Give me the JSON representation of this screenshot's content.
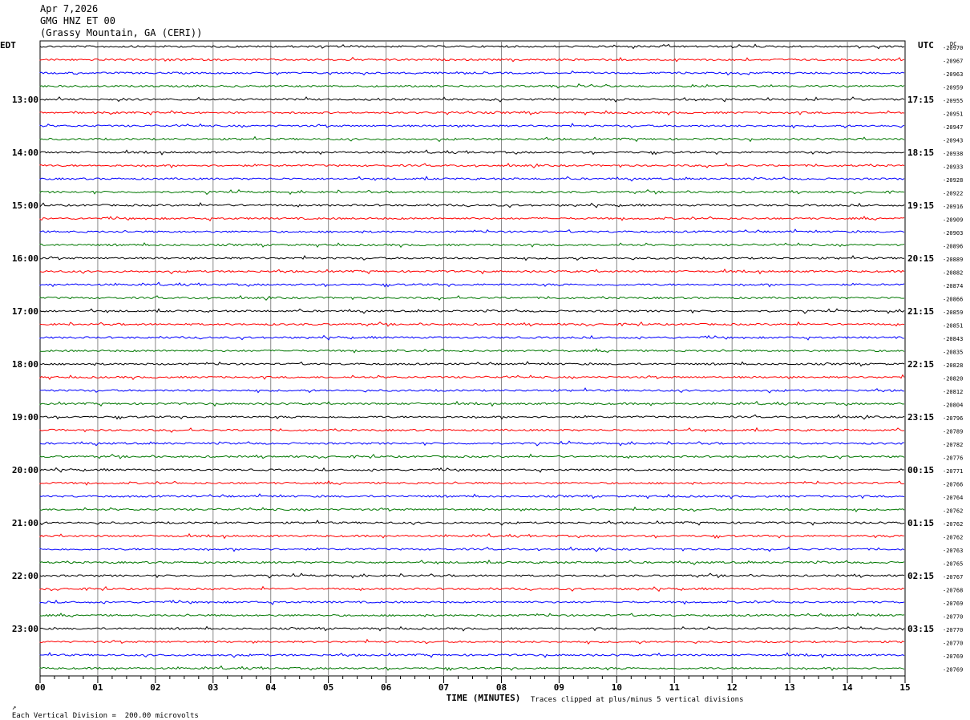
{
  "header": {
    "date": "Apr 7,2026",
    "channel": "GMG HNZ ET 00",
    "station": "(Grassy Mountain, GA (CERI))"
  },
  "chart_data": {
    "type": "line",
    "title": "GMG HNZ ET 00",
    "left_tz": "EDT",
    "right_tz": "UTC",
    "dc_label": "DC",
    "xlabel": "TIME (MINUTES)",
    "x_ticks": [
      "00",
      "01",
      "02",
      "03",
      "04",
      "05",
      "06",
      "07",
      "08",
      "09",
      "10",
      "11",
      "12",
      "13",
      "14",
      "15"
    ],
    "xlim": [
      0,
      15
    ],
    "left_hour_labels": [
      "13:00",
      "14:00",
      "15:00",
      "16:00",
      "17:00",
      "18:00",
      "19:00",
      "20:00",
      "21:00",
      "22:00",
      "23:00"
    ],
    "right_hour_labels": [
      "17:15",
      "18:15",
      "19:15",
      "20:15",
      "21:15",
      "22:15",
      "23:15",
      "00:15",
      "01:15",
      "02:15",
      "03:15"
    ],
    "trace_colors": [
      "#000000",
      "#ff0000",
      "#0000ff",
      "#007700"
    ],
    "dc_offsets": [
      "-20970",
      "-20967",
      "-20963",
      "-20959",
      "-20955",
      "-20951",
      "-20947",
      "-20943",
      "-20938",
      "-20933",
      "-20928",
      "-20922",
      "-20916",
      "-20909",
      "-20903",
      "-20896",
      "-20889",
      "-20882",
      "-20874",
      "-20866",
      "-20859",
      "-20851",
      "-20843",
      "-20835",
      "-20828",
      "-20820",
      "-20812",
      "-20804",
      "-20796",
      "-20789",
      "-20782",
      "-20776",
      "-20771",
      "-20766",
      "-20764",
      "-20762",
      "-20762",
      "-20762",
      "-20763",
      "-20765",
      "-20767",
      "-20768",
      "-20769",
      "-20770",
      "-20770",
      "-20770",
      "-20769",
      "-20769"
    ],
    "footer_scale": "Each Vertical Division =  200.00 microvolts",
    "footer_clip": "Traces clipped at plus/minus 5 vertical divisions"
  }
}
